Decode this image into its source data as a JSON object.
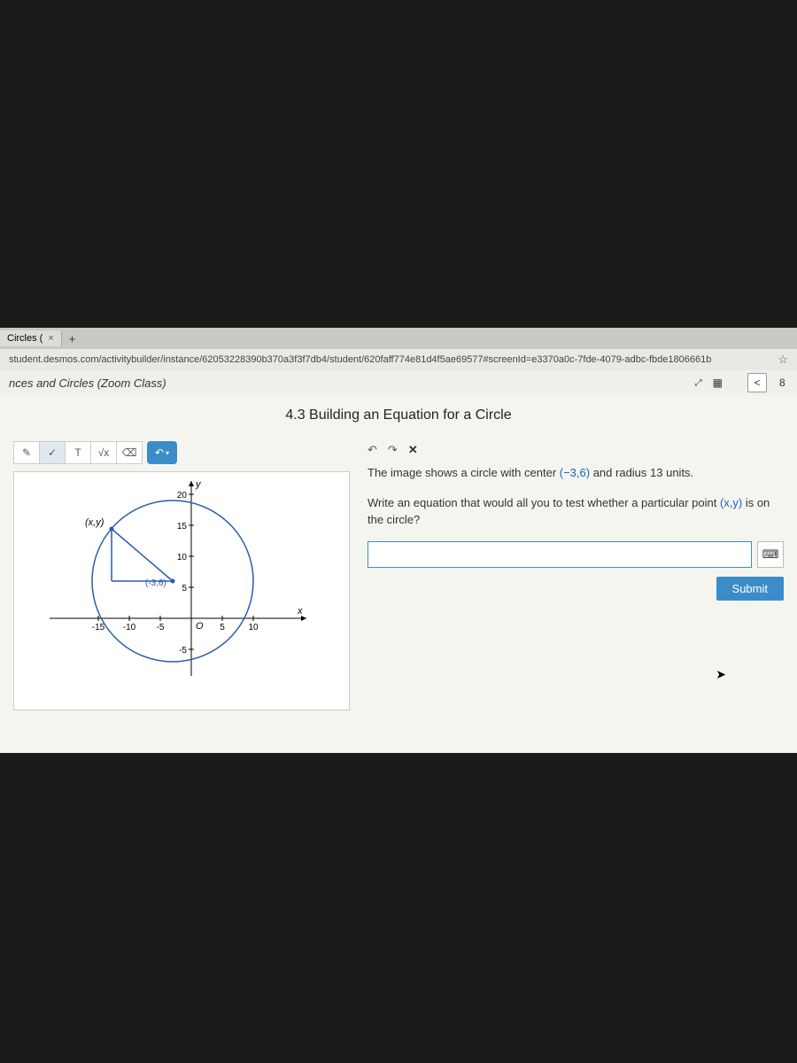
{
  "browser": {
    "tab_title": "Circles (",
    "tab_close": "×",
    "new_tab": "+",
    "url": "student.desmos.com/activitybuilder/instance/62053228390b370a3f3f7db4/student/620faff774e81d4f5ae69577#screenId=e3370a0c-7fde-4079-adbc-fbde1806661b",
    "star": "☆"
  },
  "header": {
    "class_name": "nces and Circles (Zoom Class)",
    "fullscreen": "⤢",
    "grid": "▦",
    "back": "<",
    "page_number": "8"
  },
  "page": {
    "title": "4.3 Building an Equation for a Circle"
  },
  "toolbar": {
    "pencil": "✎",
    "check": "✓",
    "text": "T",
    "sqrt": "√x",
    "eraser": "⌫",
    "mode": "↶"
  },
  "editbar": {
    "undo": "↶",
    "redo": "↷",
    "close": "✕"
  },
  "prompt": {
    "line1a": "The image shows a circle with center ",
    "coord1": "(−3,6)",
    "line1b": " and radius 13 units.",
    "line2a": "Write an equation that would all you to test whether a particular point ",
    "coord2": "(x,y)",
    "line2b": " is on the circle?"
  },
  "input": {
    "placeholder": "",
    "keyboard": "⌨",
    "submit": "Submit"
  },
  "graph": {
    "y_label": "y",
    "x_label": "x",
    "origin": "O",
    "xy_label": "(x,y)",
    "center_label": "(-3,6)",
    "ticks_x": [
      "-15",
      "-10",
      "-5",
      "5",
      "10"
    ],
    "ticks_y": [
      "-5",
      "5",
      "10",
      "15",
      "20"
    ]
  }
}
